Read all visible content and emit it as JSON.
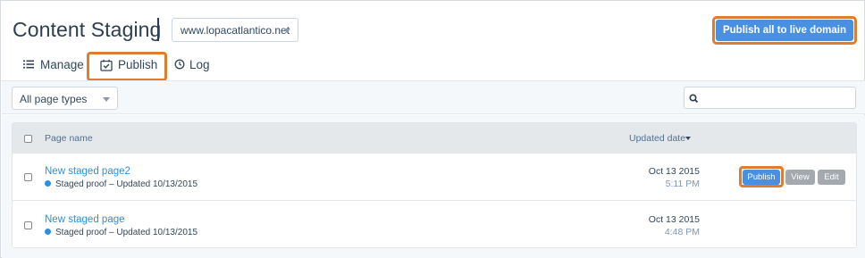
{
  "header": {
    "title": "Content Staging",
    "domain_select_value": "www.lopacatlantico.net",
    "publish_all_label": "Publish all to live domain"
  },
  "tabs": [
    {
      "label": "Manage",
      "icon": "list-icon",
      "active": false
    },
    {
      "label": "Publish",
      "icon": "calendar-check-icon",
      "active": true
    },
    {
      "label": "Log",
      "icon": "clock-icon",
      "active": false
    }
  ],
  "filters": {
    "page_type_value": "All page types",
    "search_placeholder": ""
  },
  "table": {
    "columns": {
      "name": "Page name",
      "date": "Updated date"
    },
    "rows": [
      {
        "name": "New staged page2",
        "status": "Staged proof – Updated 10/13/2015",
        "date": "Oct 13 2015",
        "time": "5:11 PM",
        "actions": {
          "publish": "Publish",
          "view": "View",
          "edit": "Edit"
        }
      },
      {
        "name": "New staged page",
        "status": "Staged proof – Updated 10/13/2015",
        "date": "Oct 13 2015",
        "time": "4:48 PM"
      }
    ]
  },
  "colors": {
    "accent": "#4a90e2",
    "highlight_ring": "#e07c2f",
    "link": "#2d8fe0",
    "secondary_button": "#a3a9ae"
  }
}
